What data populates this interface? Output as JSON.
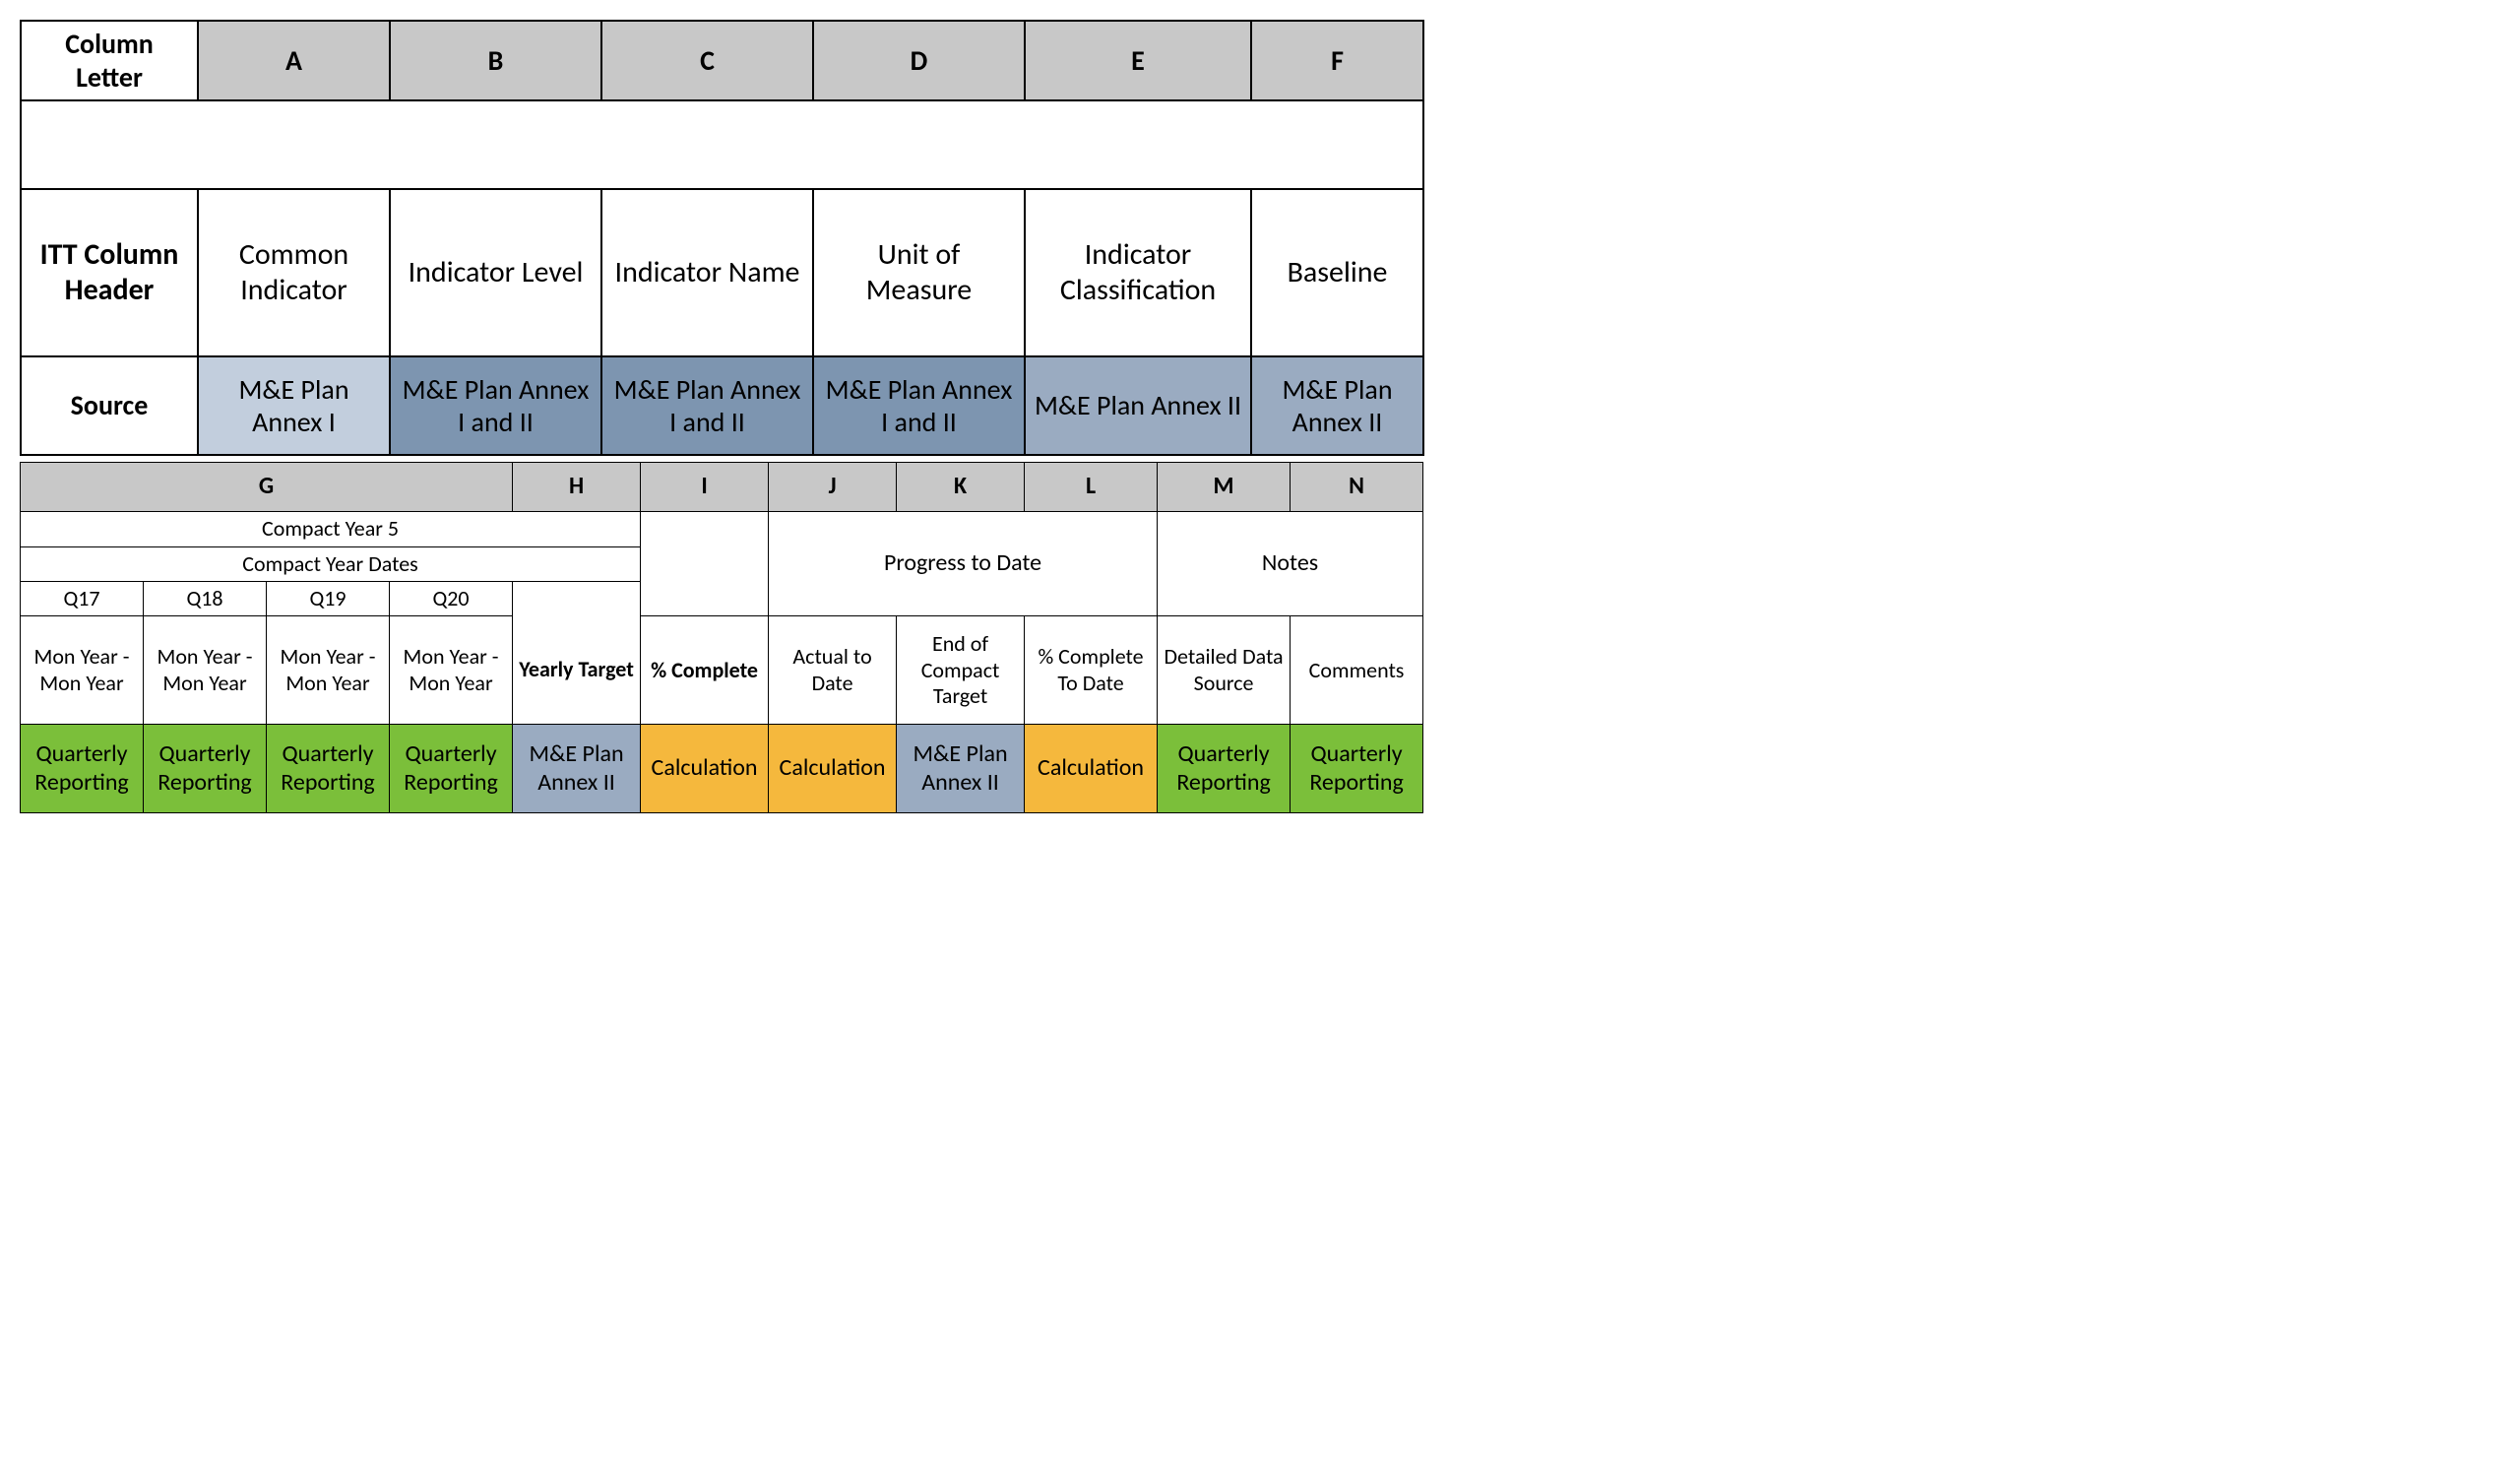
{
  "table1": {
    "row_labels": {
      "column_letter": "Column Letter",
      "itt_header": "ITT Column Header",
      "source": "Source"
    },
    "columns": [
      "A",
      "B",
      "C",
      "D",
      "E",
      "F"
    ],
    "itt_headers": [
      "Common Indicator",
      "Indicator Level",
      "Indicator Name",
      "Unit of Measure",
      "Indicator Classification",
      "Baseline"
    ],
    "sources": [
      "M&E Plan Annex I",
      "M&E Plan Annex I and II",
      "M&E Plan Annex I and II",
      "M&E Plan Annex I and II",
      "M&E Plan Annex II",
      "M&E Plan Annex II"
    ]
  },
  "table2": {
    "columns": [
      "G",
      "H",
      "I",
      "J",
      "K",
      "L",
      "M",
      "N"
    ],
    "group_g": {
      "year_label": "Compact Year 5",
      "dates_label": "Compact Year Dates",
      "quarters": [
        "Q17",
        "Q18",
        "Q19",
        "Q20"
      ],
      "quarter_range": "Mon Year - Mon Year"
    },
    "progress_label": "Progress to Date",
    "notes_label": "Notes",
    "headers": {
      "H": "Yearly Target",
      "I": "% Complete",
      "J": "Actual to Date",
      "K": "End of Compact Target",
      "L": "% Complete To Date",
      "M": "Detailed Data Source",
      "N": "Comments"
    },
    "sources": {
      "G": "Quarterly Reporting",
      "H": "M&E Plan Annex II",
      "I": "Calculation",
      "J": "Calculation",
      "K": "M&E Plan Annex II",
      "L": "Calculation",
      "M": "Quarterly Reporting",
      "N": "Quarterly Reporting"
    }
  }
}
